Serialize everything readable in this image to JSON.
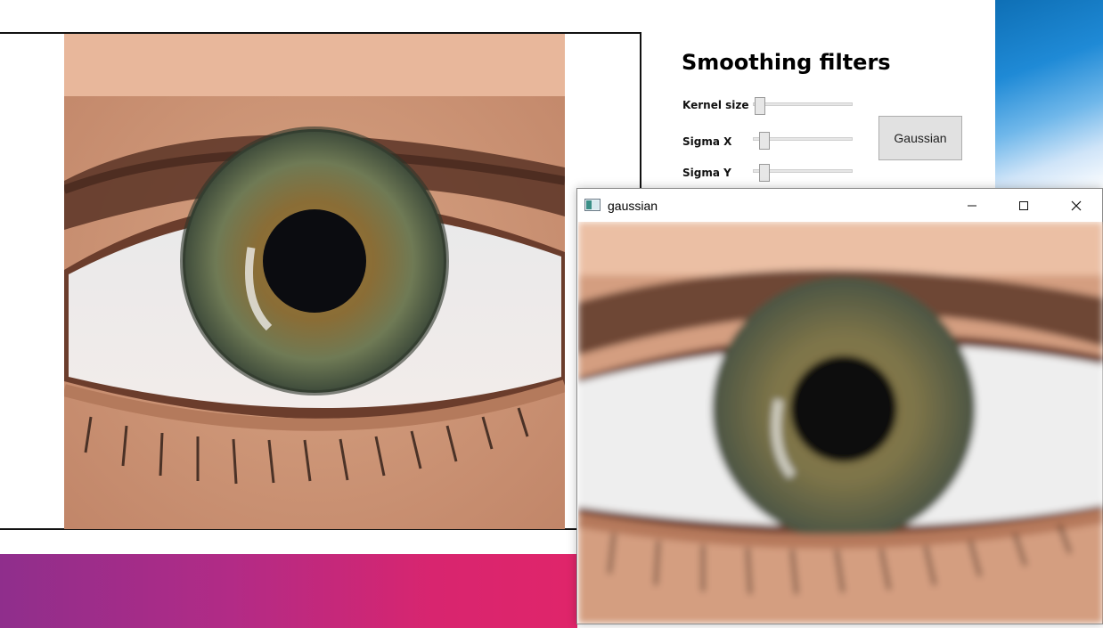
{
  "panel": {
    "title": "Smoothing filters",
    "sliders": [
      {
        "label": "Kernel size",
        "value_fraction": 0.04
      },
      {
        "label": "Sigma X",
        "value_fraction": 0.1
      },
      {
        "label": "Sigma Y",
        "value_fraction": 0.1
      }
    ],
    "gaussian_button": "Gaussian"
  },
  "popup": {
    "title": "gaussian",
    "app_icon": "image-window-icon",
    "buttons": [
      "minimize-icon",
      "maximize-icon",
      "close-icon"
    ]
  },
  "colors": {
    "desktop_blue": "#1f8ad6",
    "desktop_magenta": "#d8256f"
  }
}
